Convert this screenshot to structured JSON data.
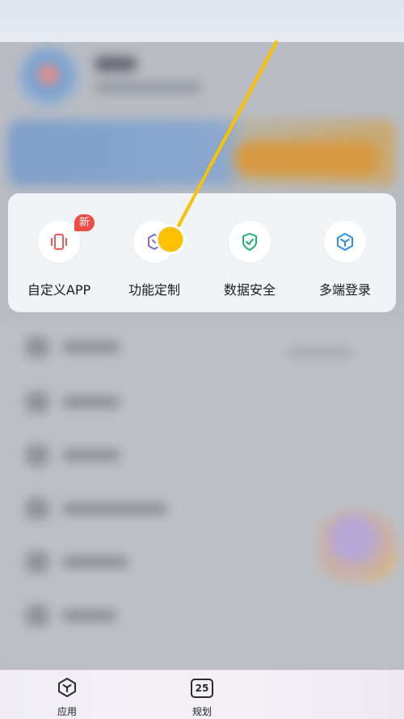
{
  "quick_actions": {
    "items": [
      {
        "label": "自定义APP",
        "icon": "phone-vibrate-icon",
        "badge": "新",
        "color": "#ef5a52"
      },
      {
        "label": "功能定制",
        "icon": "tag-customize-icon",
        "color": "#7d6be0"
      },
      {
        "label": "数据安全",
        "icon": "shield-check-icon",
        "color": "#1fae6b"
      },
      {
        "label": "多端登录",
        "icon": "cube-icon",
        "color": "#2f8fe8"
      }
    ]
  },
  "bottom_nav": {
    "items": [
      {
        "label": "应用",
        "icon": "app-hub-icon"
      },
      {
        "label": "规划",
        "icon": "calendar-icon",
        "icon_text": "25"
      }
    ]
  },
  "colors": {
    "pointer": "#fcc100",
    "badge": "#ef4c45"
  }
}
